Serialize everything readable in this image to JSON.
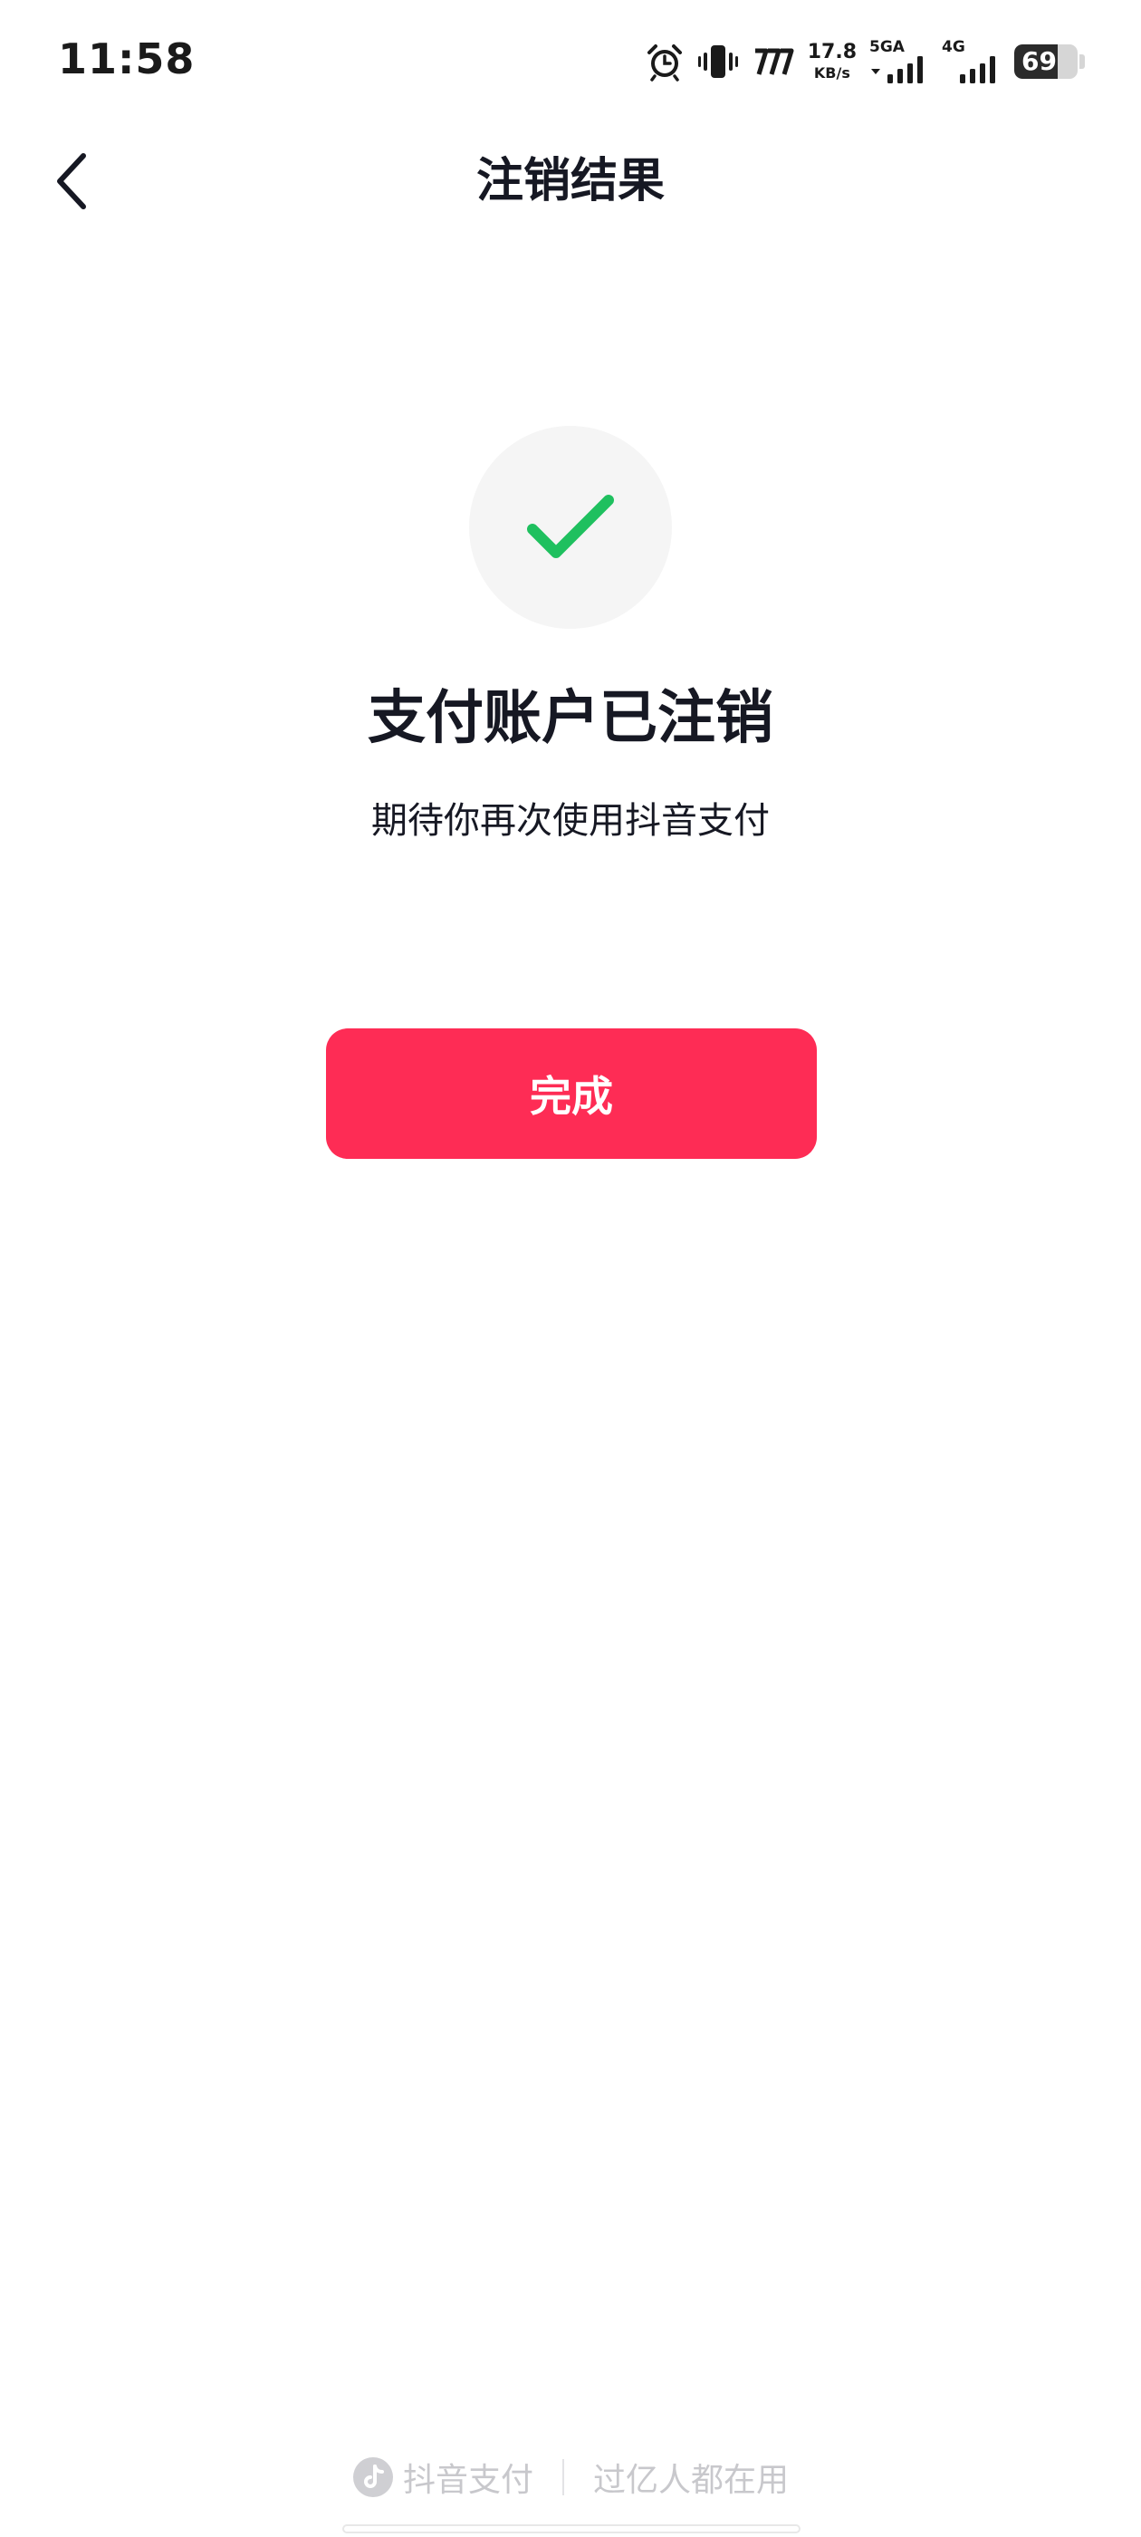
{
  "status_bar": {
    "time": "11:58",
    "network_speed_value": "17.8",
    "network_speed_unit": "KB/s",
    "sim1_label": "5GA",
    "sim2_label": "4G",
    "battery_percent": "69",
    "battery_level": 0.69,
    "icons": [
      "alarm-icon",
      "vibrate-icon",
      "nfc-icon",
      "signal-5ga-icon",
      "signal-4g-icon",
      "battery-icon"
    ]
  },
  "nav": {
    "title": "注销结果",
    "back_icon": "chevron-left-icon"
  },
  "result": {
    "icon": "check-icon",
    "icon_color": "#1fc05f",
    "title": "支付账户已注销",
    "subtitle": "期待你再次使用抖音支付"
  },
  "actions": {
    "done_label": "完成",
    "done_color": "#fe2c55"
  },
  "footer": {
    "brand_icon": "douyin-logo-icon",
    "brand_label": "抖音支付",
    "slogan": "过亿人都在用"
  }
}
